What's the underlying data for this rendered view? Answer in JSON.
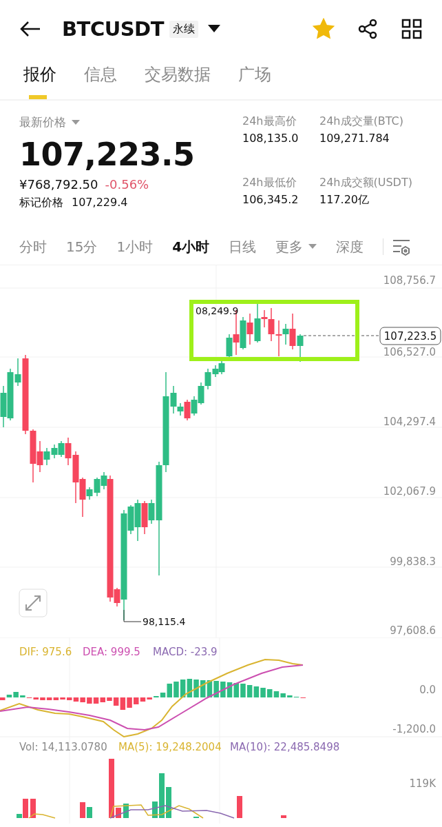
{
  "header": {
    "symbol": "BTCUSDT",
    "badge": "永续",
    "favorited": true
  },
  "tabs": [
    {
      "label": "报价",
      "selected": true
    },
    {
      "label": "信息",
      "selected": false
    },
    {
      "label": "交易数据",
      "selected": false
    },
    {
      "label": "广场",
      "selected": false
    }
  ],
  "price": {
    "label": "最新价格",
    "last": "107,223.5",
    "cny": "¥768,792.50",
    "change": "-0.56%",
    "mark_label": "标记价格",
    "mark_value": "107,229.4"
  },
  "stats": [
    {
      "label": "24h最高价",
      "value": "108,135.0"
    },
    {
      "label": "24h成交量(BTC)",
      "value": "109,271.784"
    },
    {
      "label": "24h最低价",
      "value": "106,345.2"
    },
    {
      "label": "24h成交额(USDT)",
      "value": "117.20亿"
    }
  ],
  "intervals": [
    {
      "label": "分时",
      "selected": false,
      "kind": "plain"
    },
    {
      "label": "15分",
      "selected": false,
      "kind": "plain"
    },
    {
      "label": "1小时",
      "selected": false,
      "kind": "plain"
    },
    {
      "label": "4小时",
      "selected": true,
      "kind": "plain"
    },
    {
      "label": "日线",
      "selected": false,
      "kind": "plain"
    },
    {
      "label": "更多",
      "selected": false,
      "kind": "dropdown"
    },
    {
      "label": "深度",
      "selected": false,
      "kind": "plain"
    }
  ],
  "chart": {
    "y_labels": [
      "108,756.7",
      "106,527.0",
      "104,297.4",
      "102,067.9",
      "99,838.3",
      "97,608.6"
    ],
    "high_marker": "08,249.9",
    "low_marker": "98,115.4",
    "current_price": "107,223.5"
  },
  "macd": {
    "legend": [
      {
        "label": "DIF: 975.6",
        "color": "#d9b430"
      },
      {
        "label": "DEA: 999.5",
        "color": "#cc4fb0"
      },
      {
        "label": "MACD: -23.9",
        "color": "#8a68b0"
      }
    ],
    "y_labels": [
      "0.0",
      "-1,200.0"
    ]
  },
  "volume": {
    "legend": [
      {
        "label": "Vol: 14,113.0780",
        "color": "#8a8a8a"
      },
      {
        "label": "MA(5): 19,248.2004",
        "color": "#d9b430"
      },
      {
        "label": "MA(10): 22,485.8498",
        "color": "#8a68b0"
      }
    ],
    "y_labels": [
      "119K"
    ]
  }
}
